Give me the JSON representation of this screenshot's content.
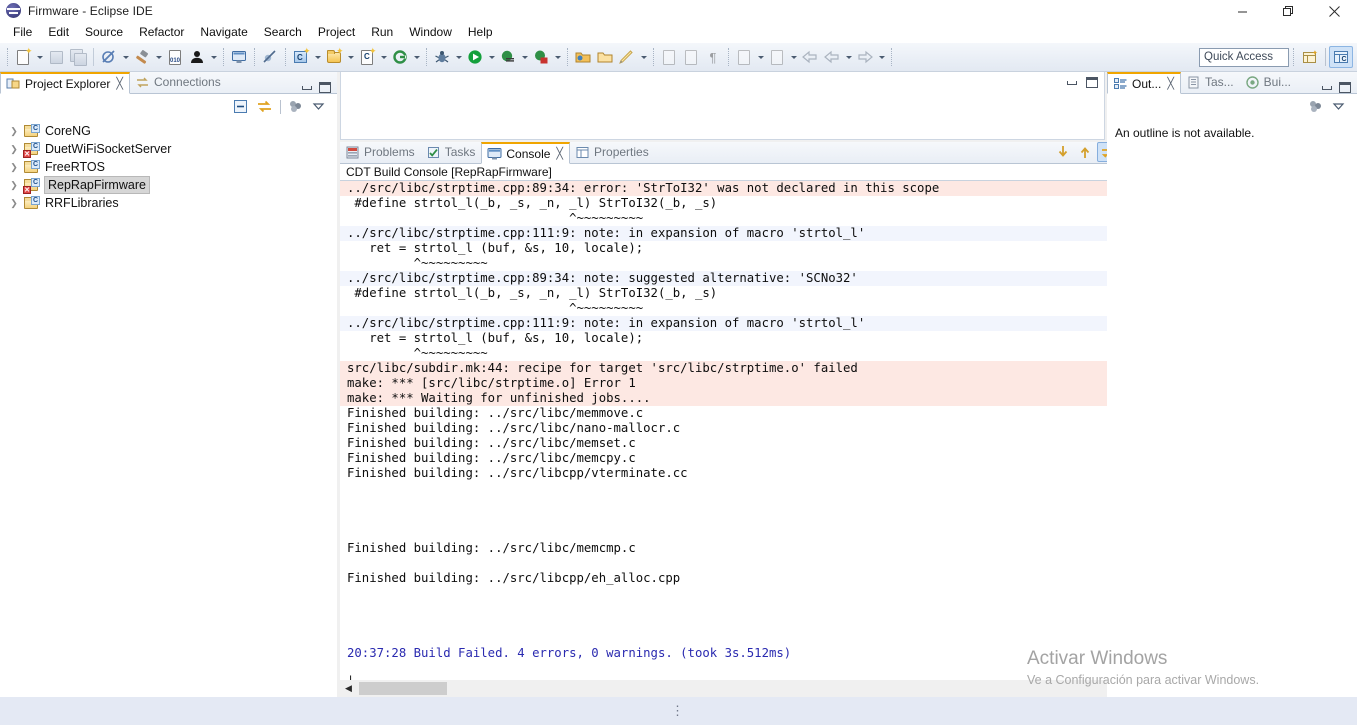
{
  "window": {
    "title": "Firmware - Eclipse IDE",
    "app_icon": "eclipse-icon",
    "minimize_label": "–",
    "maximize_label": "❐",
    "close_label": "✕"
  },
  "menubar": {
    "items": [
      {
        "label": "File"
      },
      {
        "label": "Edit"
      },
      {
        "label": "Source"
      },
      {
        "label": "Refactor"
      },
      {
        "label": "Navigate"
      },
      {
        "label": "Search"
      },
      {
        "label": "Project"
      },
      {
        "label": "Run"
      },
      {
        "label": "Window"
      },
      {
        "label": "Help"
      }
    ]
  },
  "toolbar": {
    "quick_access_value": "Quick Access",
    "quick_access_placeholder": "Quick Access",
    "groups": [
      {
        "icons": [
          "new-wizard-icon",
          "save-icon",
          "save-all-icon"
        ]
      },
      {
        "icons": [
          "no-build-icon",
          "build-hammer-icon",
          "binary-010-icon",
          "user-profile-icon"
        ]
      },
      {
        "icons": [
          "open-console-icon"
        ]
      },
      {
        "icons": [
          "skip-breakpoints-icon"
        ]
      },
      {
        "icons": [
          "new-c-project-icon",
          "new-cpp-class-icon",
          "new-c-file-icon",
          "open-element-icon"
        ]
      },
      {
        "icons": [
          "debug-bug-icon",
          "run-icon",
          "profile-icon",
          "external-tools-icon"
        ]
      },
      {
        "icons": [
          "open-resource-icon",
          "open-folder-icon",
          "pencil-icon"
        ]
      },
      {
        "icons": [
          "next-annotation-icon",
          "previous-annotation-icon",
          "pilcrow-icon"
        ]
      },
      {
        "icons": [
          "next-edit-icon",
          "last-edit-icon",
          "back-icon",
          "forward-icon",
          "forward-alt-icon"
        ]
      }
    ],
    "perspective_icons": [
      "open-perspective-icon",
      "cpp-perspective-icon"
    ]
  },
  "project_explorer": {
    "tabs": [
      {
        "label": "Project Explorer",
        "icon": "project-explorer-icon",
        "active": true,
        "closable": true
      },
      {
        "label": "Connections",
        "icon": "connections-icon",
        "active": false,
        "closable": false
      }
    ],
    "view_buttons": [
      "collapse-all-icon",
      "link-with-editor-icon",
      "view-menu-extra-icon",
      "view-menu-icon"
    ],
    "panel_buttons": [
      "minimize-icon",
      "maximize-icon"
    ],
    "tree": [
      {
        "label": "CoreNG",
        "icon": "c-project-icon",
        "has_error": false,
        "expanded": false,
        "selected": false
      },
      {
        "label": "DuetWiFiSocketServer",
        "icon": "c-project-icon",
        "has_error": true,
        "expanded": false,
        "selected": false
      },
      {
        "label": "FreeRTOS",
        "icon": "c-project-icon",
        "has_error": false,
        "expanded": false,
        "selected": false
      },
      {
        "label": "RepRapFirmware",
        "icon": "c-project-icon",
        "has_error": true,
        "expanded": false,
        "selected": true
      },
      {
        "label": "RRFLibraries",
        "icon": "c-project-icon",
        "has_error": false,
        "expanded": false,
        "selected": false
      }
    ]
  },
  "editor_area": {
    "panel_buttons": [
      "minimize-icon",
      "maximize-icon"
    ]
  },
  "console_view": {
    "tabs": [
      {
        "label": "Problems",
        "icon": "problems-icon",
        "active": false,
        "closable": false
      },
      {
        "label": "Tasks",
        "icon": "tasks-icon",
        "active": false,
        "closable": false
      },
      {
        "label": "Console",
        "icon": "console-icon",
        "active": true,
        "closable": true
      },
      {
        "label": "Properties",
        "icon": "properties-icon",
        "active": false,
        "closable": false
      }
    ],
    "toolbar_icons": [
      "scroll-lock-down-icon",
      "scroll-lock-up-icon",
      "pin-console-icon",
      "save-console-icon",
      "lock-console-icon",
      "clear-console-icon",
      "remove-console-icon",
      "new-console-view-icon",
      "display-console-icon",
      "open-console-icon",
      "minimize-icon",
      "maximize-icon"
    ],
    "title": "CDT Build Console [RepRapFirmware]",
    "lines": [
      {
        "text": "../src/libc/strptime.cpp:89:34: error: 'StrToI32' was not declared in this scope",
        "style": "err"
      },
      {
        "text": " #define strtol_l(_b, _s, _n, _l) StrToI32(_b, _s)",
        "style": "plain"
      },
      {
        "text": "                              ^~~~~~~~~~",
        "style": "plain"
      },
      {
        "text": "../src/libc/strptime.cpp:111:9: note: in expansion of macro 'strtol_l'",
        "style": "note"
      },
      {
        "text": "   ret = strtol_l (buf, &s, 10, locale);",
        "style": "plain"
      },
      {
        "text": "         ^~~~~~~~~~",
        "style": "plain"
      },
      {
        "text": "../src/libc/strptime.cpp:89:34: note: suggested alternative: 'SCNo32'",
        "style": "note"
      },
      {
        "text": " #define strtol_l(_b, _s, _n, _l) StrToI32(_b, _s)",
        "style": "plain"
      },
      {
        "text": "                              ^~~~~~~~~~",
        "style": "plain"
      },
      {
        "text": "../src/libc/strptime.cpp:111:9: note: in expansion of macro 'strtol_l'",
        "style": "note"
      },
      {
        "text": "   ret = strtol_l (buf, &s, 10, locale);",
        "style": "plain"
      },
      {
        "text": "         ^~~~~~~~~~",
        "style": "plain"
      },
      {
        "text": "src/libc/subdir.mk:44: recipe for target 'src/libc/strptime.o' failed",
        "style": "err"
      },
      {
        "text": "make: *** [src/libc/strptime.o] Error 1",
        "style": "err"
      },
      {
        "text": "make: *** Waiting for unfinished jobs....",
        "style": "err"
      },
      {
        "text": "Finished building: ../src/libc/memmove.c",
        "style": "plain"
      },
      {
        "text": "Finished building: ../src/libc/nano-mallocr.c",
        "style": "plain"
      },
      {
        "text": "Finished building: ../src/libc/memset.c",
        "style": "plain"
      },
      {
        "text": "Finished building: ../src/libc/memcpy.c",
        "style": "plain"
      },
      {
        "text": "Finished building: ../src/libcpp/vterminate.cc",
        "style": "plain"
      },
      {
        "text": "",
        "style": "plain"
      },
      {
        "text": "",
        "style": "plain"
      },
      {
        "text": "",
        "style": "plain"
      },
      {
        "text": "",
        "style": "plain"
      },
      {
        "text": "Finished building: ../src/libc/memcmp.c",
        "style": "plain"
      },
      {
        "text": "",
        "style": "plain"
      },
      {
        "text": "Finished building: ../src/libcpp/eh_alloc.cpp",
        "style": "plain"
      },
      {
        "text": "",
        "style": "plain"
      },
      {
        "text": "",
        "style": "plain"
      },
      {
        "text": "",
        "style": "plain"
      },
      {
        "text": "",
        "style": "plain"
      },
      {
        "text": "20:37:28 Build Failed. 4 errors, 0 warnings. (took 3s.512ms)",
        "style": "blue"
      },
      {
        "text": "",
        "style": "plain"
      },
      {
        "text": "│",
        "style": "plain"
      }
    ]
  },
  "outline_view": {
    "tabs": [
      {
        "label": "Out...",
        "icon": "outline-icon",
        "active": true,
        "closable": true
      },
      {
        "label": "Tas...",
        "icon": "task-list-icon",
        "active": false,
        "closable": false
      },
      {
        "label": "Bui...",
        "icon": "build-targets-icon",
        "active": false,
        "closable": false
      }
    ],
    "view_buttons": [
      "view-menu-extra-icon",
      "view-menu-icon"
    ],
    "panel_buttons": [
      "minimize-icon",
      "maximize-icon"
    ],
    "message": "An outline is not available."
  },
  "watermark": {
    "title": "Activar Windows",
    "subtitle": "Ve a Configuración para activar Windows."
  },
  "statusbar": {
    "grip": "⋮"
  },
  "colors": {
    "error_bg": "#fde8e3",
    "note_bg": "#f2f5fd",
    "build_failed_text": "#2a2ab0",
    "tab_accent": "#f0a500",
    "selection": "#d6d6d6",
    "toolbar_bg": "#eaeff6",
    "statusbar_bg": "#e4e9f4"
  }
}
